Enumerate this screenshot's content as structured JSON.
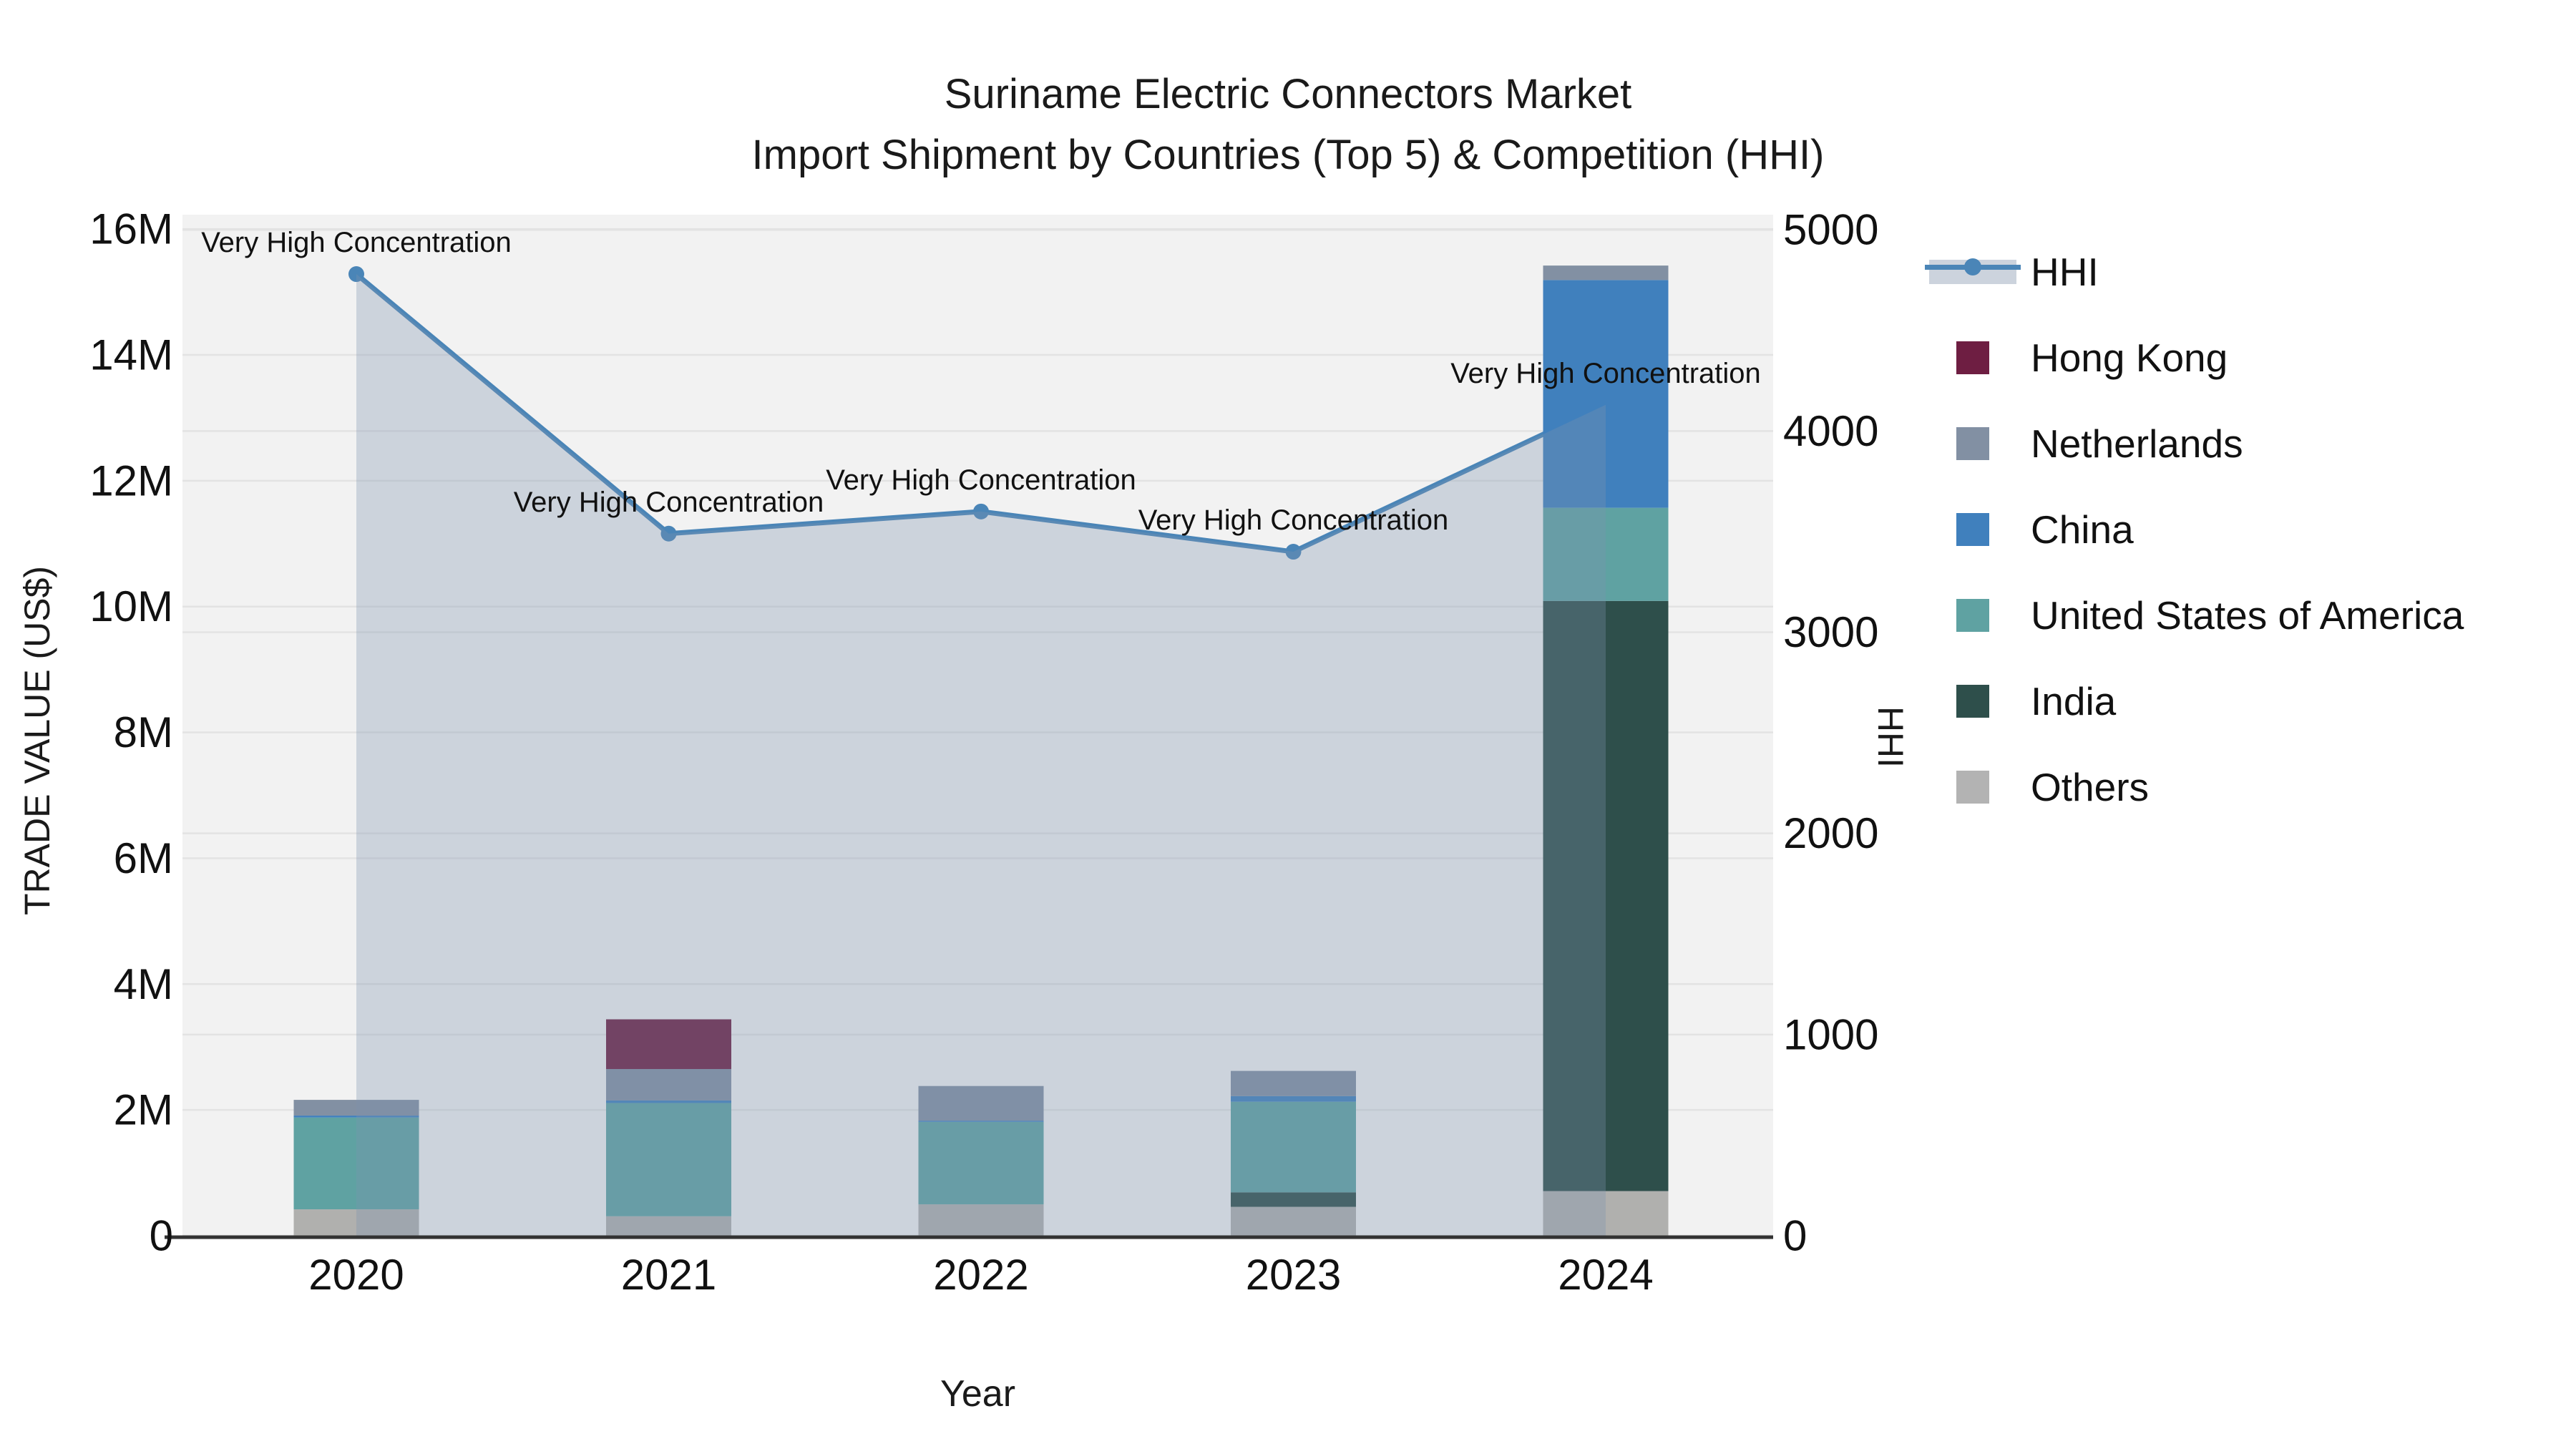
{
  "title": {
    "line1": "Suriname Electric Connectors Market",
    "line2": "Import Shipment by Countries (Top 5) & Competition (HHI)"
  },
  "axes": {
    "x_label": "Year",
    "y_left_label": "TRADE VALUE (US$)",
    "y_right_label": "HHI"
  },
  "legend": {
    "items": [
      {
        "label": "HHI",
        "type": "line",
        "color": "#4a85b7"
      },
      {
        "label": "Hong Kong",
        "type": "swatch",
        "color": "#6e1e42"
      },
      {
        "label": "Netherlands",
        "type": "swatch",
        "color": "#8290a3"
      },
      {
        "label": "China",
        "type": "swatch",
        "color": "#4080bd"
      },
      {
        "label": "United States of America",
        "type": "swatch",
        "color": "#5fa2a2"
      },
      {
        "label": "India",
        "type": "swatch",
        "color": "#2e4f4b"
      },
      {
        "label": "Others",
        "type": "swatch",
        "color": "#b3b3b3"
      }
    ]
  },
  "chart_data": {
    "type": "bar+line",
    "title": "Suriname Electric Connectors Market — Import Shipment by Countries (Top 5) & Competition (HHI)",
    "categories": [
      "2020",
      "2021",
      "2022",
      "2023",
      "2024"
    ],
    "xlabel": "Year",
    "ylabel_left": "TRADE VALUE (US$)",
    "ylabel_right": "HHI",
    "value_unit": "millions of US$",
    "stack_order_bottom_to_top": [
      "Others",
      "India",
      "United States of America",
      "China",
      "Netherlands",
      "Hong Kong"
    ],
    "series": [
      {
        "name": "Others",
        "color": "#b0b0ae",
        "values": [
          0.42,
          0.31,
          0.5,
          0.46,
          0.71
        ]
      },
      {
        "name": "India",
        "color": "#2e4f4b",
        "values": [
          0,
          0,
          0,
          0.23,
          9.38
        ]
      },
      {
        "name": "United States of America",
        "color": "#5fa2a2",
        "values": [
          1.46,
          1.8,
          1.31,
          1.44,
          1.48
        ]
      },
      {
        "name": "China",
        "color": "#4080bd",
        "values": [
          0.03,
          0.04,
          0.02,
          0.09,
          3.62
        ]
      },
      {
        "name": "Netherlands",
        "color": "#8290a3",
        "values": [
          0.25,
          0.5,
          0.55,
          0.4,
          0.23
        ]
      },
      {
        "name": "Hong Kong",
        "color": "#6e1e42",
        "values": [
          0,
          0.79,
          0,
          0,
          0
        ]
      }
    ],
    "bar_totals": [
      2.16,
      3.44,
      2.38,
      2.62,
      15.42
    ],
    "line_series": {
      "name": "HHI",
      "color": "#4a85b7",
      "area_fill": "rgba(125,145,175,0.32)",
      "values": [
        4780,
        3490,
        3600,
        3400,
        4130
      ]
    },
    "annotations": [
      "Very High Concentration",
      "Very High Concentration",
      "Very High Concentration",
      "Very High Concentration",
      "Very High Concentration"
    ],
    "ylim_left_millions": [
      0,
      16.2
    ],
    "ylim_right": [
      0,
      5075
    ],
    "y_left_ticks": [
      {
        "value": 0,
        "label": "0"
      },
      {
        "value": 2,
        "label": "2M"
      },
      {
        "value": 4,
        "label": "4M"
      },
      {
        "value": 6,
        "label": "6M"
      },
      {
        "value": 8,
        "label": "8M"
      },
      {
        "value": 10,
        "label": "10M"
      },
      {
        "value": 12,
        "label": "12M"
      },
      {
        "value": 14,
        "label": "14M"
      },
      {
        "value": 16,
        "label": "16M"
      }
    ],
    "y_right_ticks": [
      {
        "value": 0,
        "label": "0"
      },
      {
        "value": 1000,
        "label": "1000"
      },
      {
        "value": 2000,
        "label": "2000"
      },
      {
        "value": 3000,
        "label": "3000"
      },
      {
        "value": 4000,
        "label": "4000"
      },
      {
        "value": 5000,
        "label": "5000"
      }
    ],
    "grid": true,
    "legend_position": "right",
    "plot_bg": "#f2f2f2",
    "grid_color": "#e3e3e3",
    "axis_line_color": "#333333",
    "text_color": "#111111"
  }
}
